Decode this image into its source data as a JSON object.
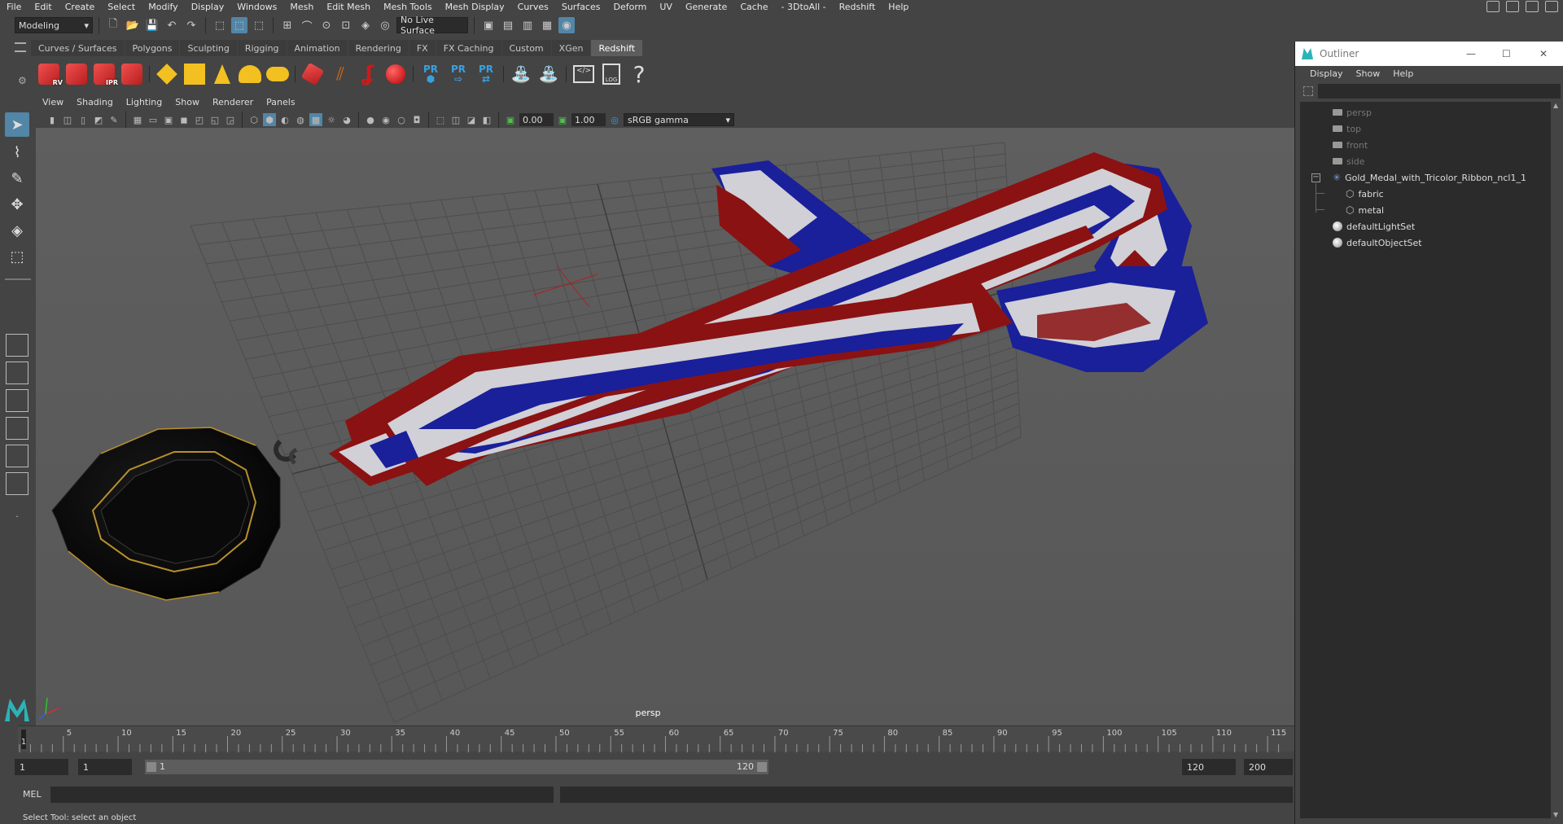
{
  "menubar": {
    "items": [
      "File",
      "Edit",
      "Create",
      "Select",
      "Modify",
      "Display",
      "Windows",
      "Mesh",
      "Edit Mesh",
      "Mesh Tools",
      "Mesh Display",
      "Curves",
      "Surfaces",
      "Deform",
      "UV",
      "Generate",
      "Cache",
      "- 3DtoAll -",
      "Redshift",
      "Help"
    ]
  },
  "statusline": {
    "mode": "Modeling",
    "live_surface": "No Live Surface"
  },
  "shelf": {
    "tabs": [
      "Curves / Surfaces",
      "Polygons",
      "Sculpting",
      "Rigging",
      "Animation",
      "Rendering",
      "FX",
      "FX Caching",
      "Custom",
      "XGen",
      "Redshift"
    ],
    "active_tab": "Redshift",
    "badges": {
      "rv": "RV",
      "ipr": "IPR",
      "pr": "PR",
      "log": "LOG",
      "help": "?"
    }
  },
  "viewport": {
    "menu": [
      "View",
      "Shading",
      "Lighting",
      "Show",
      "Renderer",
      "Panels"
    ],
    "exposure": "0.00",
    "gamma": "1.00",
    "color_space": "sRGB gamma",
    "camera_label": "persp",
    "colors": {
      "red": "#8a1212",
      "white": "#d8d8dc",
      "blue": "#1a1f9a",
      "medal": "#111111",
      "gold": "#b8902c"
    }
  },
  "timeline": {
    "ticks": [
      "5",
      "10",
      "15",
      "20",
      "25",
      "30",
      "35",
      "40",
      "45",
      "50",
      "55",
      "60",
      "65",
      "70",
      "75",
      "80",
      "85",
      "90",
      "95",
      "100",
      "105",
      "110",
      "115"
    ],
    "current_frame": "1"
  },
  "range": {
    "start": "1",
    "playback_start": "1",
    "slider_start": "1",
    "slider_end": "120",
    "playback_end": "120",
    "end": "200"
  },
  "cmdline": {
    "label": "MEL"
  },
  "helpline": {
    "text": "Select Tool: select an object"
  },
  "outliner": {
    "title": "Outliner",
    "menu": [
      "Display",
      "Show",
      "Help"
    ],
    "items": [
      {
        "label": "persp",
        "kind": "camera"
      },
      {
        "label": "top",
        "kind": "camera"
      },
      {
        "label": "front",
        "kind": "camera"
      },
      {
        "label": "side",
        "kind": "camera"
      },
      {
        "label": "Gold_Medal_with_Tricolor_Ribbon_ncl1_1",
        "kind": "group"
      },
      {
        "label": "fabric",
        "kind": "mesh"
      },
      {
        "label": "metal",
        "kind": "mesh"
      },
      {
        "label": "defaultLightSet",
        "kind": "set"
      },
      {
        "label": "defaultObjectSet",
        "kind": "set"
      }
    ]
  }
}
